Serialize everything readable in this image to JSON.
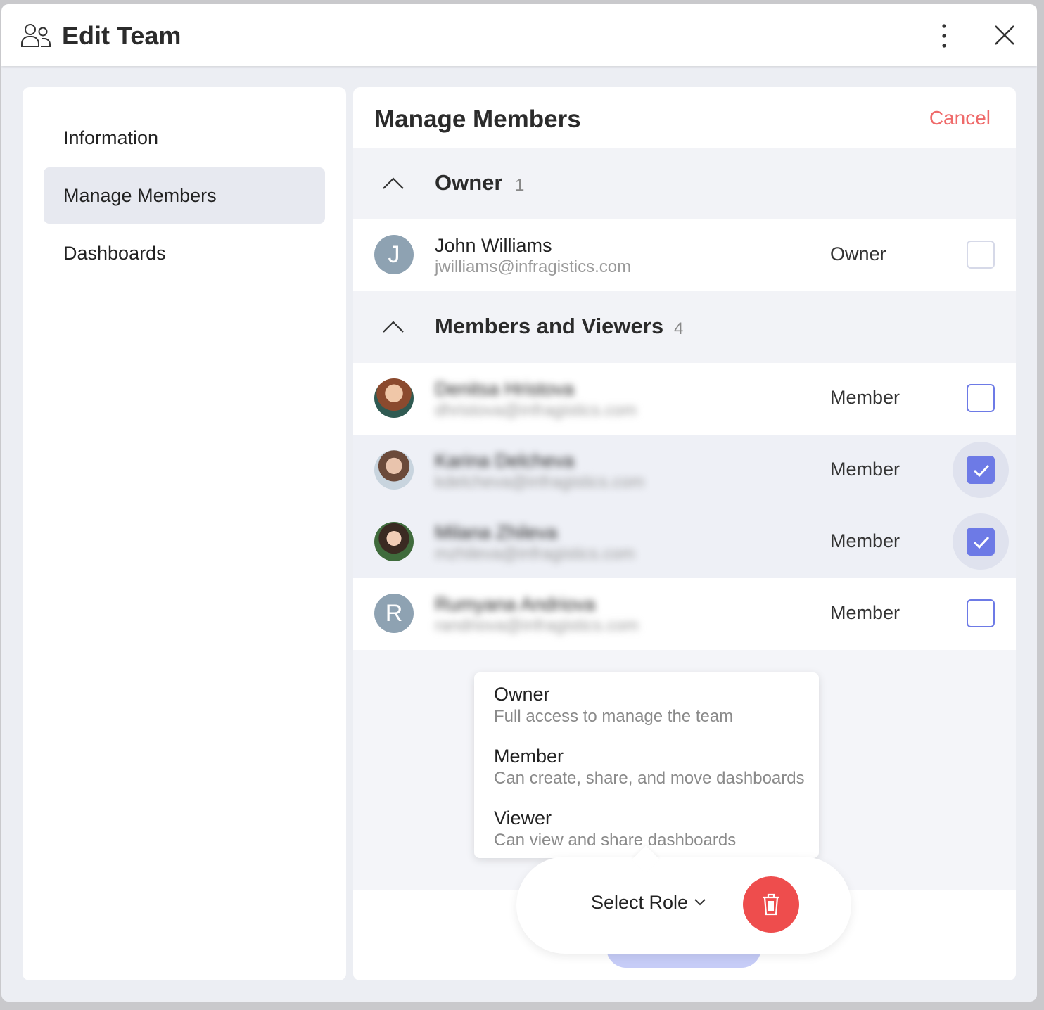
{
  "window": {
    "title": "Edit Team"
  },
  "sidebar": {
    "items": [
      {
        "label": "Information",
        "active": false
      },
      {
        "label": "Manage Members",
        "active": true
      },
      {
        "label": "Dashboards",
        "active": false
      }
    ]
  },
  "main": {
    "title": "Manage Members",
    "cancel_label": "Cancel",
    "owner_group": {
      "label": "Owner",
      "count": "1",
      "members": [
        {
          "initial": "J",
          "name": "John Williams",
          "email": "jwilliams@infragistics.com",
          "role": "Owner",
          "checked": false
        }
      ]
    },
    "members_group": {
      "label": "Members and Viewers",
      "count": "4",
      "members": [
        {
          "name": "Denitsa Hristova",
          "email": "dhristova@infragistics.com",
          "role": "Member",
          "checked": false,
          "avatar": "photo"
        },
        {
          "name": "Karina Delcheva",
          "email": "kdelcheva@infragistics.com",
          "role": "Member",
          "checked": true,
          "avatar": "photo"
        },
        {
          "name": "Milana Zhileva",
          "email": "mzhileva@infragistics.com",
          "role": "Member",
          "checked": true,
          "avatar": "photo"
        },
        {
          "initial": "R",
          "name": "Rumyana Andriova",
          "email": "randriova@infragistics.com",
          "role": "Member",
          "checked": false,
          "avatar": "letter"
        }
      ]
    }
  },
  "role_menu": {
    "options": [
      {
        "title": "Owner",
        "description": "Full access to manage the team"
      },
      {
        "title": "Member",
        "description": "Can create, share, and move dashboards"
      },
      {
        "title": "Viewer",
        "description": "Can view and share dashboards"
      }
    ]
  },
  "action_bar": {
    "select_role_label": "Select Role"
  },
  "colors": {
    "accent": "#6d7ae6",
    "danger": "#ee4d4d",
    "cancel": "#ef6a6a"
  },
  "icons": [
    "team-icon",
    "more-vertical-icon",
    "close-icon",
    "chevron-up-icon",
    "check-icon",
    "chevron-down-icon",
    "trash-icon"
  ]
}
